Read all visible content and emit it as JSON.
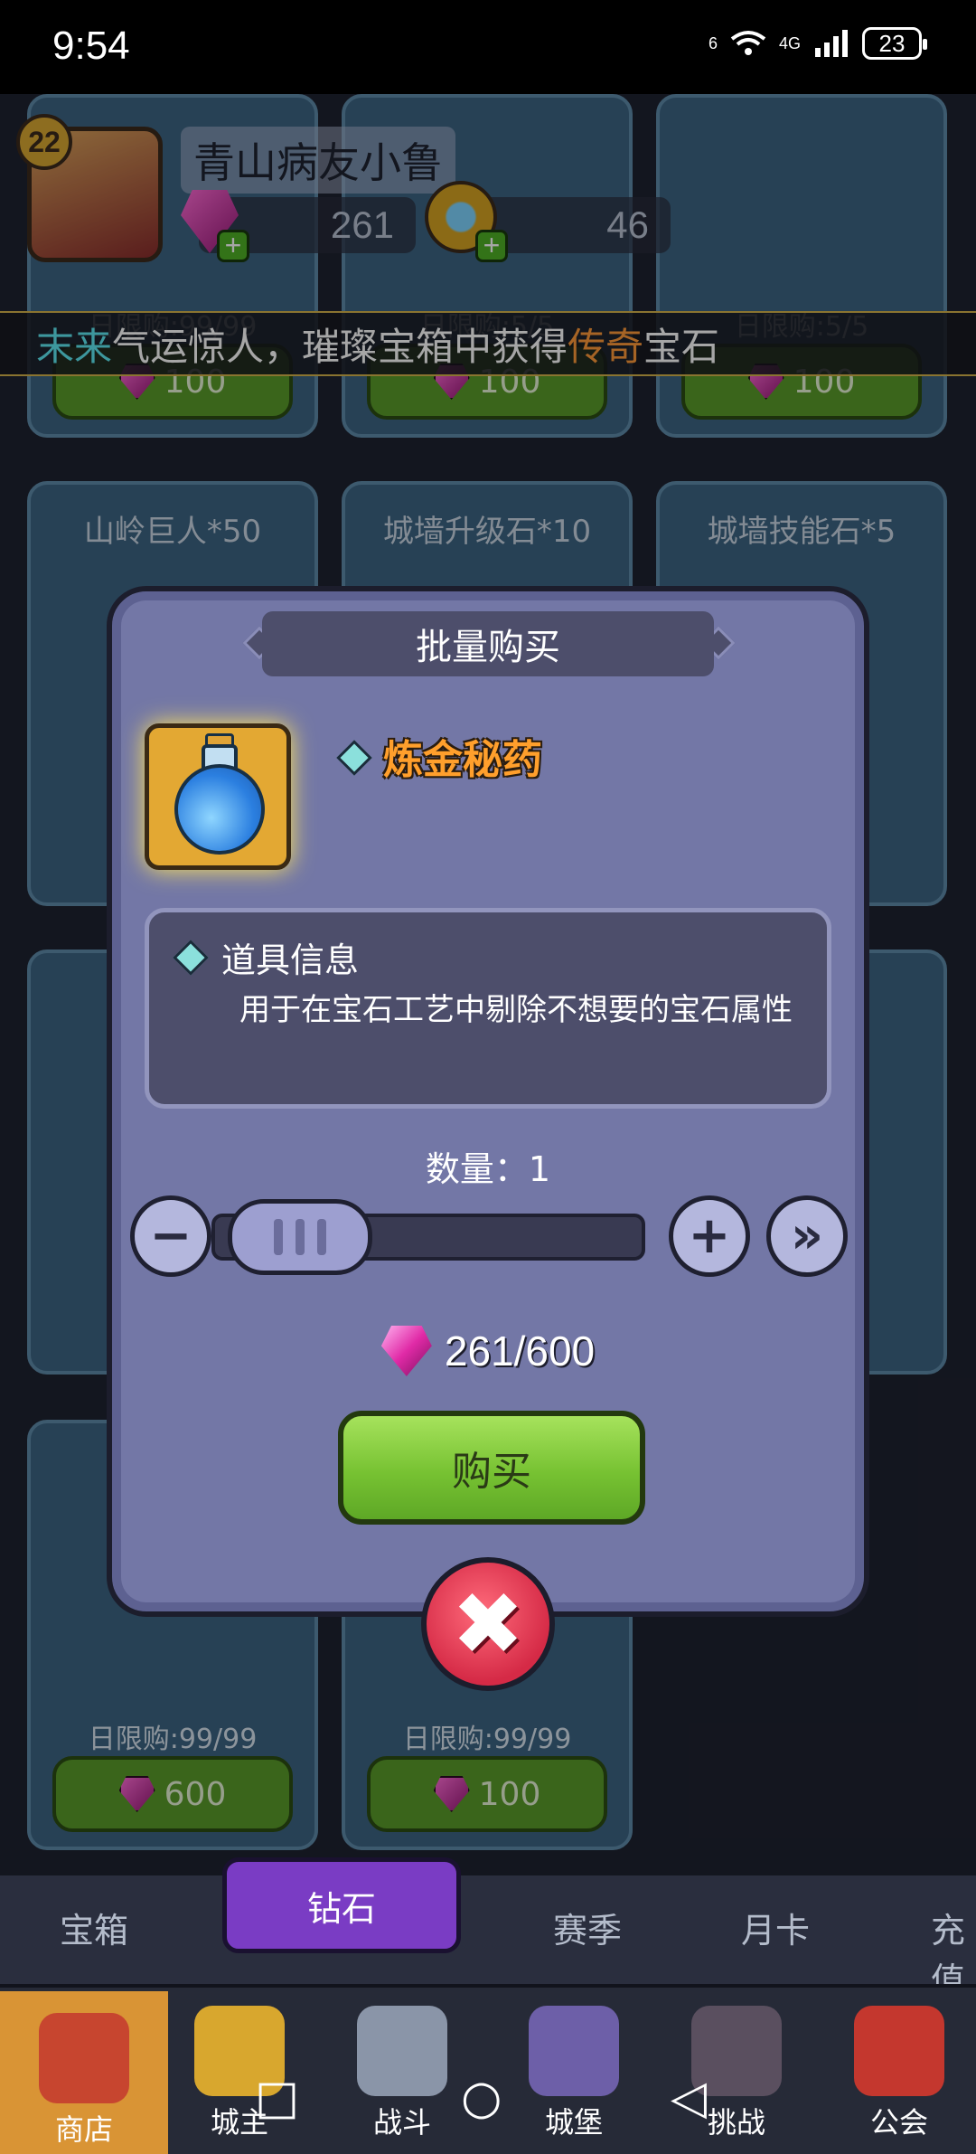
{
  "status_bar": {
    "time": "9:54",
    "network": "4G",
    "signal": "6",
    "battery": "23"
  },
  "profile": {
    "level": "22",
    "name": "青山病友小鲁",
    "gems": "261",
    "coins": "46"
  },
  "announcement": {
    "name": "末来",
    "text_before": "气运惊人，璀璨宝箱中获得",
    "rarity": "传奇",
    "text_after": "宝石"
  },
  "shop_cards": [
    {
      "title": "",
      "limit": "日限购:99/99",
      "price": "100"
    },
    {
      "title": "",
      "limit": "日限购:5/5",
      "price": "100"
    },
    {
      "title": "",
      "limit": "日限购:5/5",
      "price": "100"
    },
    {
      "title": "山岭巨人*50"
    },
    {
      "title": "城墙升级石*10"
    },
    {
      "title": "城墙技能石*5"
    },
    {
      "title": "",
      "limit": "日限购:99/99",
      "price": "600"
    },
    {
      "title": "",
      "limit": "日限购:99/99",
      "price": "100"
    }
  ],
  "dialog": {
    "title": "批量购买",
    "item_name": "炼金秘药",
    "info_title": "道具信息",
    "info_desc": "用于在宝石工艺中剔除不想要的宝石属性",
    "quantity_label": "数量：1",
    "quantity_value": 1,
    "price_text": "261/600",
    "buy_label": "购买",
    "minus_symbol": "−",
    "plus_symbol": "+",
    "max_symbol": "»",
    "close_symbol": "✖"
  },
  "tabs": {
    "items": [
      "宝箱",
      "钻石",
      "赛季",
      "月卡",
      "充值"
    ],
    "active": "钻石"
  },
  "bottom_nav": {
    "items": [
      "商店",
      "城主",
      "战斗",
      "城堡",
      "挑战",
      "公会"
    ],
    "active": "商店"
  },
  "system_nav": {
    "recent": "□",
    "home": "○",
    "back": "◁"
  },
  "colors": {
    "accent_green": "#77c232",
    "dialog_bg": "#7377a6",
    "close_red": "#d52a46",
    "rare_orange": "#ff9a3a",
    "name_cyan": "#5ee8f2"
  }
}
